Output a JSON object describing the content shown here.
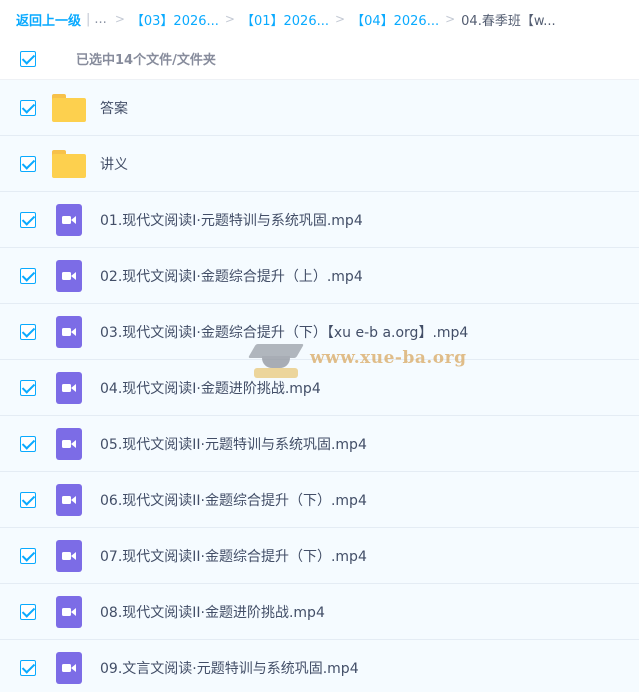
{
  "breadcrumb": {
    "back": "返回上一级",
    "ellipsis": "...",
    "crumbs": [
      "【03】2026...",
      "【01】2026...",
      "【04】2026..."
    ],
    "current": "04.春季班【w..."
  },
  "selection": {
    "text": "已选中14个文件/文件夹"
  },
  "files": [
    {
      "name": "答案",
      "type": "folder"
    },
    {
      "name": "讲义",
      "type": "folder"
    },
    {
      "name": "01.现代文阅读Ⅰ·元题特训与系统巩固.mp4",
      "type": "video"
    },
    {
      "name": "02.现代文阅读Ⅰ·金题综合提升（上）.mp4",
      "type": "video"
    },
    {
      "name": "03.现代文阅读Ⅰ·金题综合提升（下）【xu e-b a.org】.mp4",
      "type": "video"
    },
    {
      "name": "04.现代文阅读Ⅰ·金题进阶挑战.mp4",
      "type": "video"
    },
    {
      "name": "05.现代文阅读II·元题特训与系统巩固.mp4",
      "type": "video"
    },
    {
      "name": "06.现代文阅读II·金题综合提升（下）.mp4",
      "type": "video"
    },
    {
      "name": "07.现代文阅读II·金题综合提升（下）.mp4",
      "type": "video"
    },
    {
      "name": "08.现代文阅读II·金题进阶挑战.mp4",
      "type": "video"
    },
    {
      "name": "09.文言文阅读·元题特训与系统巩固.mp4",
      "type": "video"
    }
  ],
  "watermark": {
    "text": "www.xue-ba.org"
  },
  "colors": {
    "accent": "#09aaff",
    "folder": "#fdd04e",
    "video": "#7c6ce6",
    "row_bg": "#f5fbff"
  }
}
